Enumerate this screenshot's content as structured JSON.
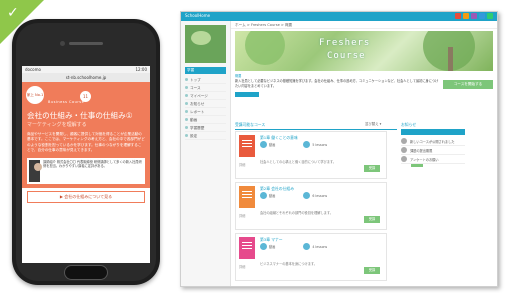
{
  "mobile": {
    "status_left": "docomo",
    "status_right": "12:00",
    "url": "st-nb.schoolhome.jp",
    "logo_text": "家上 No.1",
    "badge": "11",
    "subtitle": "Business Course",
    "title": "会社の仕組み・仕事の仕組み①",
    "title_sub": "マーケティングを理解する",
    "paragraph": "商品やサービスを開発し、顧客に提供して対価を得ることが企業活動の基本です。ここでは、マーケティングの考え方と、会社の中で各部門がどのような役割を担っているかを学びます。仕事のつながりを理解することで、自分の仕事の意味が見えてきます。",
    "person_caption": "講師紹介 株式会社〇〇 代表取締役 研修講師として多くの新入社員研修を担当。わかりやすい講義に定評がある。",
    "footer_link": "▶ 会社の仕組みについて見る"
  },
  "desktop": {
    "topbar_title": "SchoolHome",
    "icon_colors": [
      "#e74c3c",
      "#f39c12",
      "#9b59b6",
      "#3498db",
      "#2ecc71"
    ],
    "sidebar": {
      "header": "学習",
      "items": [
        "トップ",
        "コース",
        "マイページ",
        "お知らせ",
        "レポート",
        "動画",
        "学習履歴",
        "設定"
      ]
    },
    "breadcrumb": "ホーム > Freshers Course > 概要",
    "banner_line1": "Freshers",
    "banner_line2": "Course",
    "intro_label": "概要",
    "intro_text": "新入社員として必要なビジネスの基礎知識を学びます。会社の仕組み、仕事の進め方、コミュニケーションなど、社会人として最初に身につけたい内容をまとめています。",
    "intro_button": "コースを開始する",
    "section_title": "受講可能なコース",
    "section_controls": "並び替え ▾",
    "right_title": "お知らせ",
    "cards": [
      {
        "title": "第1章 働くことの意味",
        "meta1": "動画",
        "meta2": "5 lessons",
        "desc": "社会人としての心構えと働く目的について学びます。",
        "button": "受講"
      },
      {
        "title": "第2章 会社の仕組み",
        "meta1": "動画",
        "meta2": "6 lessons",
        "desc": "会社の組織とそれぞれの部門の役割を理解します。",
        "button": "受講"
      },
      {
        "title": "第3章 マナー",
        "meta1": "動画",
        "meta2": "4 lessons",
        "desc": "ビジネスマナーの基本を身につけます。",
        "button": "受講"
      }
    ],
    "card_small": "詳細",
    "right_items": [
      "新しいコースが公開されました",
      "課題の提出期限",
      "アンケートのお願い"
    ]
  }
}
